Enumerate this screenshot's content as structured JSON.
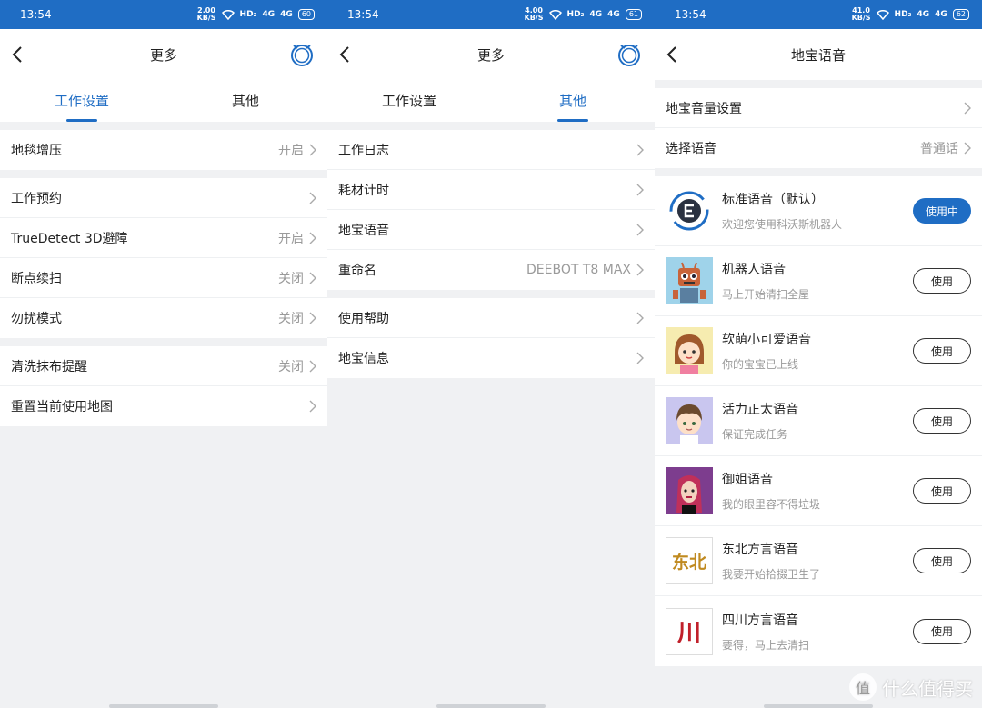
{
  "status": {
    "p1": {
      "time": "13:54",
      "speed": "2.00",
      "speed_unit": "KB/S",
      "net": "HD₂",
      "sig1": "4G",
      "sig2": "4G",
      "battery": "60"
    },
    "p2": {
      "time": "13:54",
      "speed": "4.00",
      "speed_unit": "KB/S",
      "net": "HD₂",
      "sig1": "4G",
      "sig2": "4G",
      "battery": "61"
    },
    "p3": {
      "time": "13:54",
      "speed": "41.0",
      "speed_unit": "KB/S",
      "net": "HD₂",
      "sig1": "4G",
      "sig2": "4G",
      "battery": "62"
    }
  },
  "screen1": {
    "title": "更多",
    "tabs": [
      "工作设置",
      "其他"
    ],
    "group1": [
      {
        "label": "地毯增压",
        "value": "开启"
      }
    ],
    "group2": [
      {
        "label": "工作预约",
        "value": ""
      },
      {
        "label": "TrueDetect 3D避障",
        "value": "开启"
      },
      {
        "label": "断点续扫",
        "value": "关闭"
      },
      {
        "label": "勿扰模式",
        "value": "关闭"
      }
    ],
    "group3": [
      {
        "label": "清洗抹布提醒",
        "value": "关闭"
      },
      {
        "label": "重置当前使用地图",
        "value": ""
      }
    ]
  },
  "screen2": {
    "title": "更多",
    "tabs": [
      "工作设置",
      "其他"
    ],
    "group1": [
      {
        "label": "工作日志",
        "value": ""
      },
      {
        "label": "耗材计时",
        "value": ""
      },
      {
        "label": "地宝语音",
        "value": ""
      },
      {
        "label": "重命名",
        "value": "DEEBOT T8 MAX"
      }
    ],
    "group2": [
      {
        "label": "使用帮助",
        "value": ""
      },
      {
        "label": "地宝信息",
        "value": ""
      }
    ]
  },
  "screen3": {
    "title": "地宝语音",
    "settings": [
      {
        "label": "地宝音量设置",
        "value": ""
      },
      {
        "label": "选择语音",
        "value": "普通话"
      }
    ],
    "voices": [
      {
        "name": "标准语音（默认）",
        "desc": "欢迎您使用科沃斯机器人",
        "button": "使用中",
        "active": true
      },
      {
        "name": "机器人语音",
        "desc": "马上开始清扫全屋",
        "button": "使用",
        "active": false
      },
      {
        "name": "软萌小可爱语音",
        "desc": "你的宝宝已上线",
        "button": "使用",
        "active": false
      },
      {
        "name": "活力正太语音",
        "desc": "保证完成任务",
        "button": "使用",
        "active": false
      },
      {
        "name": "御姐语音",
        "desc": "我的眼里容不得垃圾",
        "button": "使用",
        "active": false
      },
      {
        "name": "东北方言语音",
        "desc": "我要开始拾掇卫生了",
        "button": "使用",
        "active": false
      },
      {
        "name": "四川方言语音",
        "desc": "要得，马上去清扫",
        "button": "使用",
        "active": false
      }
    ],
    "avatar_text": {
      "dongbei": "东北",
      "sichuan": "川"
    }
  },
  "watermark": {
    "logo": "值",
    "text": "什么值得买"
  },
  "colors": {
    "accent": "#1f6dc4",
    "background": "#f0f1f3",
    "muted": "#9a9a9a"
  },
  "icons": {
    "back": "chevron-left-icon",
    "chevron": "chevron-right-icon",
    "robot": "robot-vacuum-icon"
  }
}
